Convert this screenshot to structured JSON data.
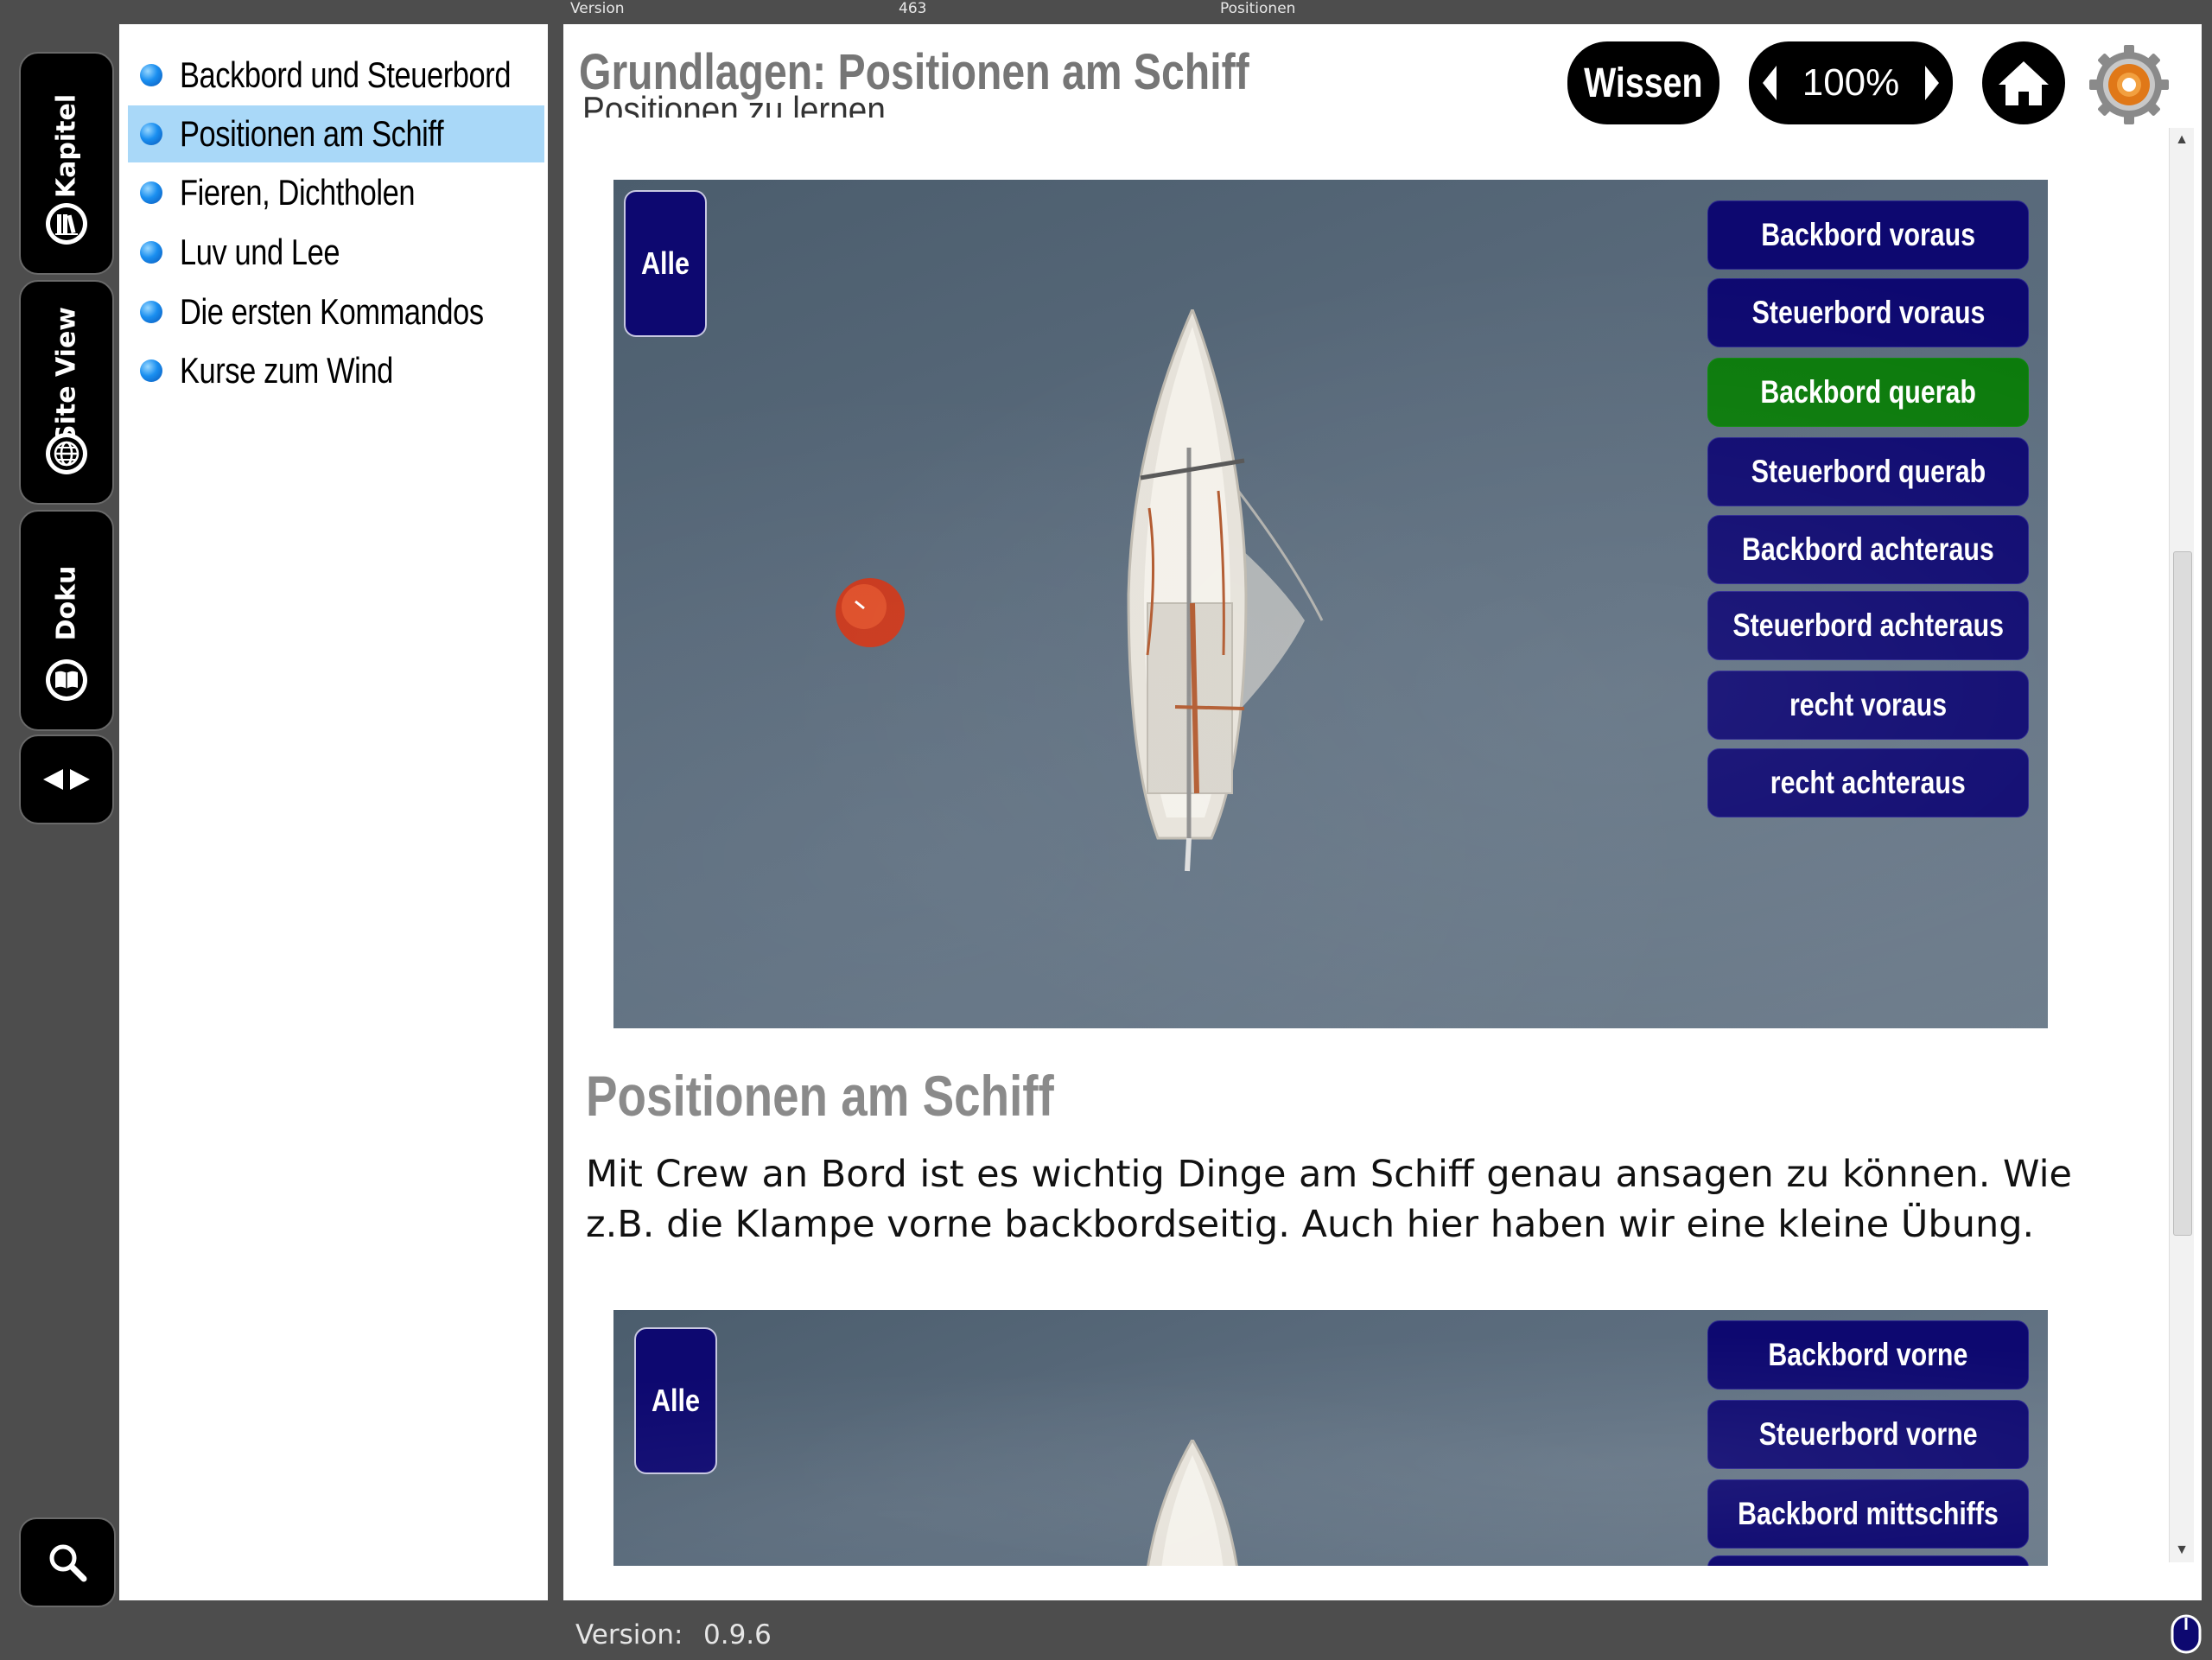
{
  "top_status": {
    "left": "Version",
    "middle": "463",
    "right": "Positionen"
  },
  "sidebar_tabs": [
    {
      "label": "Kapitel",
      "icon": "books-icon"
    },
    {
      "label": "Site View",
      "icon": "globe-icon"
    },
    {
      "label": "Doku",
      "icon": "book-icon"
    }
  ],
  "nav_toggle": {
    "icon": "left-right-arrows-icon"
  },
  "search": {
    "icon": "search-icon"
  },
  "chapters": [
    {
      "label": "Backbord und Steuerbord",
      "active": false
    },
    {
      "label": "Positionen am Schiff",
      "active": true
    },
    {
      "label": "Fieren, Dichtholen",
      "active": false
    },
    {
      "label": "Luv und Lee",
      "active": false
    },
    {
      "label": "Die ersten Kommandos",
      "active": false
    },
    {
      "label": "Kurse zum Wind",
      "active": false
    }
  ],
  "header": {
    "title": "Grundlagen: Positionen am Schiff",
    "wissen_label": "Wissen",
    "zoom": "100%"
  },
  "clipped_text": "Positionen zu lernen.",
  "exercise1": {
    "all_label": "Alle",
    "options": [
      {
        "label": "Backbord voraus",
        "state": "default"
      },
      {
        "label": "Steuerbord voraus",
        "state": "default"
      },
      {
        "label": "Backbord querab",
        "state": "correct"
      },
      {
        "label": "Steuerbord querab",
        "state": "default"
      },
      {
        "label": "Backbord achteraus",
        "state": "default"
      },
      {
        "label": "Steuerbord achteraus",
        "state": "default"
      },
      {
        "label": "recht voraus",
        "state": "default"
      },
      {
        "label": "recht achteraus",
        "state": "default"
      }
    ]
  },
  "section": {
    "title": "Positionen am Schiff",
    "body": "Mit Crew an Bord ist es wichtig Dinge am Schiff genau ansagen zu können. Wie z.B. die Klampe vorne backbordseitig.  Auch hier haben wir eine kleine Übung."
  },
  "exercise2": {
    "all_label": "Alle",
    "options": [
      {
        "label": "Backbord vorne"
      },
      {
        "label": "Steuerbord vorne"
      },
      {
        "label": "Backbord mittschiffs"
      }
    ]
  },
  "footer": {
    "version_label": "Version:",
    "version_value": "0.9.6"
  },
  "colors": {
    "button_navy": "#0d0870",
    "button_correct": "#0a7a0a",
    "active_chapter": "#a9d8f8",
    "water": "#58697a"
  }
}
